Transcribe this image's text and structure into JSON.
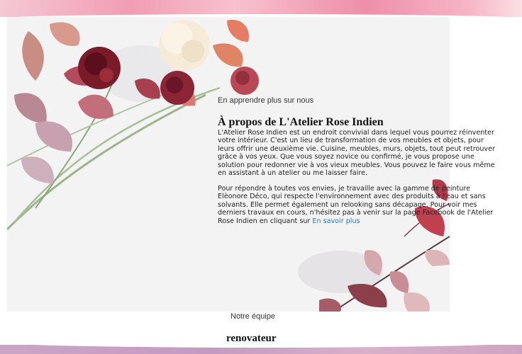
{
  "about": {
    "subtitle": "En apprendre plus sur nous",
    "title": "À propos de L'Atelier Rose Indien",
    "paragraph1": "L'Atelier Rose Indien est un endroit convivial dans lequel vous pourrez réinventer votre intérieur. C'est un lieu de transformation de vos meubles et objets, pour leurs offrir une deuxième vie. Cuisine, meubles, murs, objets, tout peut retrouver grâce à vos yeux. Que vous soyez novice ou confirmé, je vous propose une solution pour redonner vie à vos vieux meubles. Vous pouvez le faire vous même en assistant à un atelier ou me laisser faire.",
    "paragraph2": "Pour répondre à toutes vos envies, je travaille avec la gamme de peinture Elèonore Déco, qui respecte l'environnement avec des produits à l'eau et sans solvants. Elle permet également un relooking sans décapage. Pour voir mes derniers travaux en cours, n'hésitez pas à venir sur la page Facebook de l'Atelier Rose Indien en cliquant sur",
    "link_text": "En savoir plus"
  },
  "team": {
    "label": "Notre équipe",
    "name": "renovateur"
  },
  "colors": {
    "link": "#2a74c9",
    "banner_top": "#f19db3",
    "banner_bottom": "#c59ac1"
  }
}
